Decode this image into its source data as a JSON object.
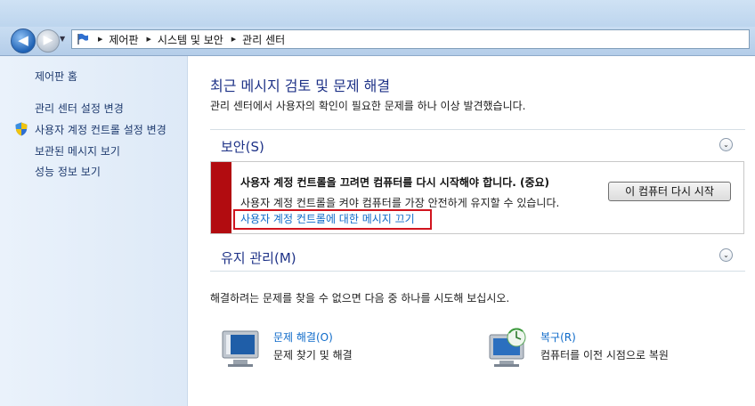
{
  "nav": {
    "back_arrow": "◀",
    "forward_arrow": "▶",
    "history_arrow": "▼",
    "breadcrumbs": [
      "제어판",
      "시스템 및 보안",
      "관리 센터"
    ],
    "breadcrumb_separator": "▶"
  },
  "sidebar": {
    "home": "제어판 홈",
    "items": [
      "관리 센터 설정 변경",
      "사용자 계정 컨트롤 설정 변경",
      "보관된 메시지 보기",
      "성능 정보 보기"
    ]
  },
  "main": {
    "title": "최근 메시지 검토 및 문제 해결",
    "subtitle": "관리 센터에서 사용자의 확인이 필요한 문제를 하나 이상 발견했습니다.",
    "security": {
      "heading": "보안(S)",
      "alert_title": "사용자 계정 컨트롤을 끄려면 컴퓨터를 다시 시작해야 합니다. (중요)",
      "alert_desc": "사용자 계정 컨트롤을 켜야 컴퓨터를 가장 안전하게 유지할 수 있습니다.",
      "alert_link": "사용자 계정 컨트롤에 대한 메시지 끄기",
      "restart_button": "이 컴퓨터 다시 시작"
    },
    "maintenance": {
      "heading": "유지 관리(M)"
    },
    "chevron": "⌄",
    "hint": "해결하려는 문제를 찾을 수 없으면 다음 중 하나를 시도해 보십시오.",
    "tools": [
      {
        "link": "문제 해결(O)",
        "desc": "문제 찾기 및 해결",
        "icon": "troubleshoot-icon"
      },
      {
        "link": "복구(R)",
        "desc": "컴퓨터를 이전 시점으로 복원",
        "icon": "recovery-icon"
      }
    ]
  },
  "colors": {
    "alert_red": "#b20c10",
    "link_blue": "#0e6ac9",
    "heading_blue": "#1e3287"
  }
}
